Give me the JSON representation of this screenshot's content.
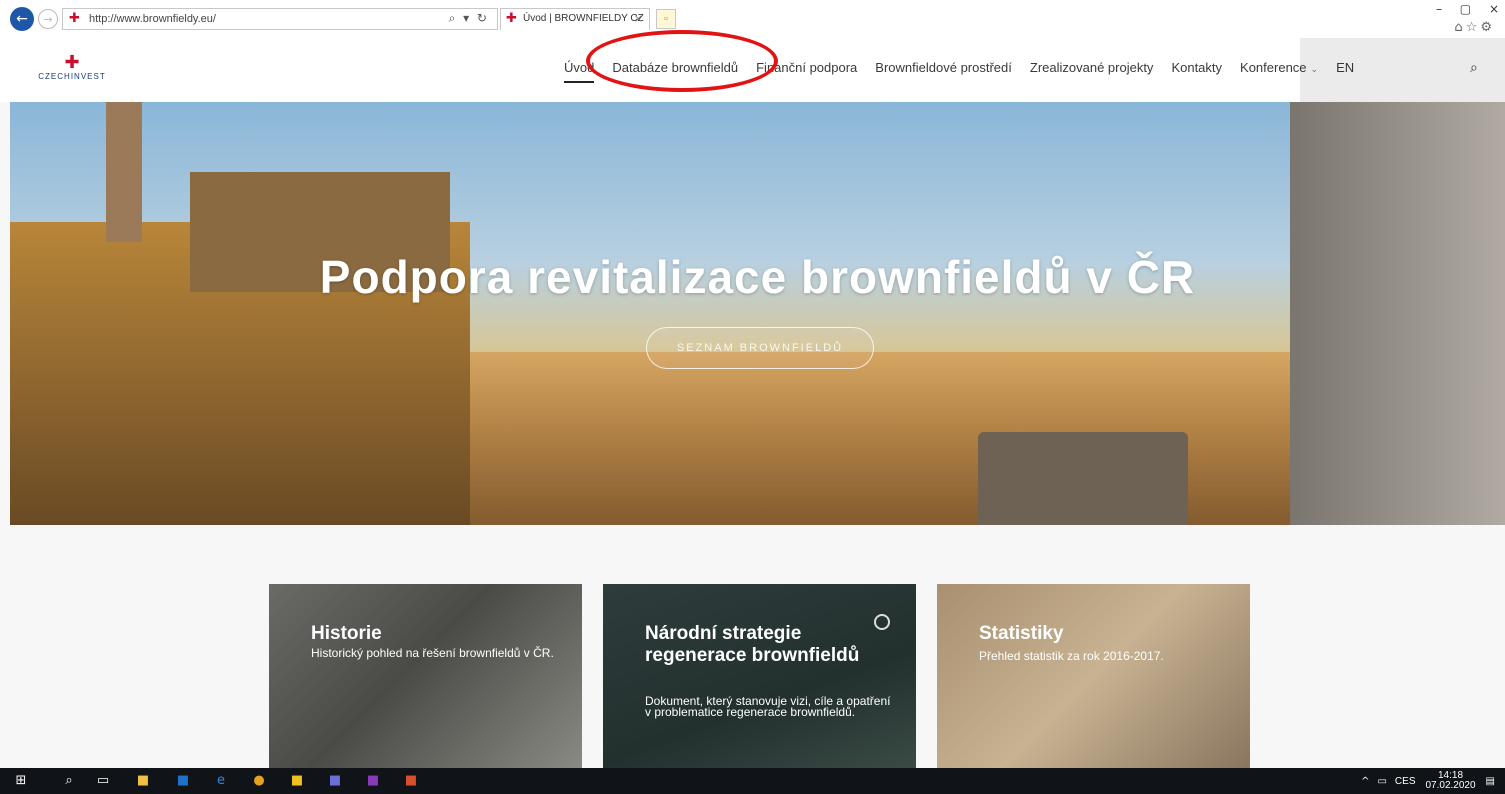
{
  "browser": {
    "back_icon": "back-arrow-icon",
    "forward_icon": "forward-arrow-icon",
    "url": "http://www.brownfieldy.eu/",
    "address_tools": "⌕ ▾ ↻",
    "tab_title": "Úvod | BROWNFIELDY CZ",
    "tab_close": "×",
    "window_controls": [
      "–",
      "▢",
      "×"
    ],
    "toolbar_icons": [
      "home-icon",
      "star-icon",
      "gear-icon"
    ]
  },
  "site": {
    "logo_text": "CZECHINVEST",
    "menu": [
      {
        "label": "Úvod",
        "active": true
      },
      {
        "label": "Databáze brownfieldů"
      },
      {
        "label": "Finanční podpora"
      },
      {
        "label": "Brownfieldové prostředí"
      },
      {
        "label": "Zrealizované projekty"
      },
      {
        "label": "Kontakty"
      },
      {
        "label": "Konference",
        "has_dropdown": true
      },
      {
        "label": "EN"
      }
    ]
  },
  "hero": {
    "title": "Podpora revitalizace brownfieldů v ČR",
    "button": "SEZNAM BROWNFIELDŮ"
  },
  "cards": [
    {
      "title": "Historie",
      "desc": "Historický pohled na řešení brownfieldů v ČR."
    },
    {
      "title": "Národní strategie regenerace brownfieldů",
      "desc": "Dokument, který stanovuje vizi, cíle a opatření v problematice regenerace brownfieldů."
    },
    {
      "title": "Statistiky",
      "desc": "Přehled statistik za rok 2016-2017."
    }
  ],
  "taskbar": {
    "language": "CES",
    "time": "14:18",
    "date": "07.02.2020"
  },
  "colors": {
    "annotation": "#e21313",
    "brand_red": "#c8102e",
    "brand_blue": "#1e3a78"
  }
}
